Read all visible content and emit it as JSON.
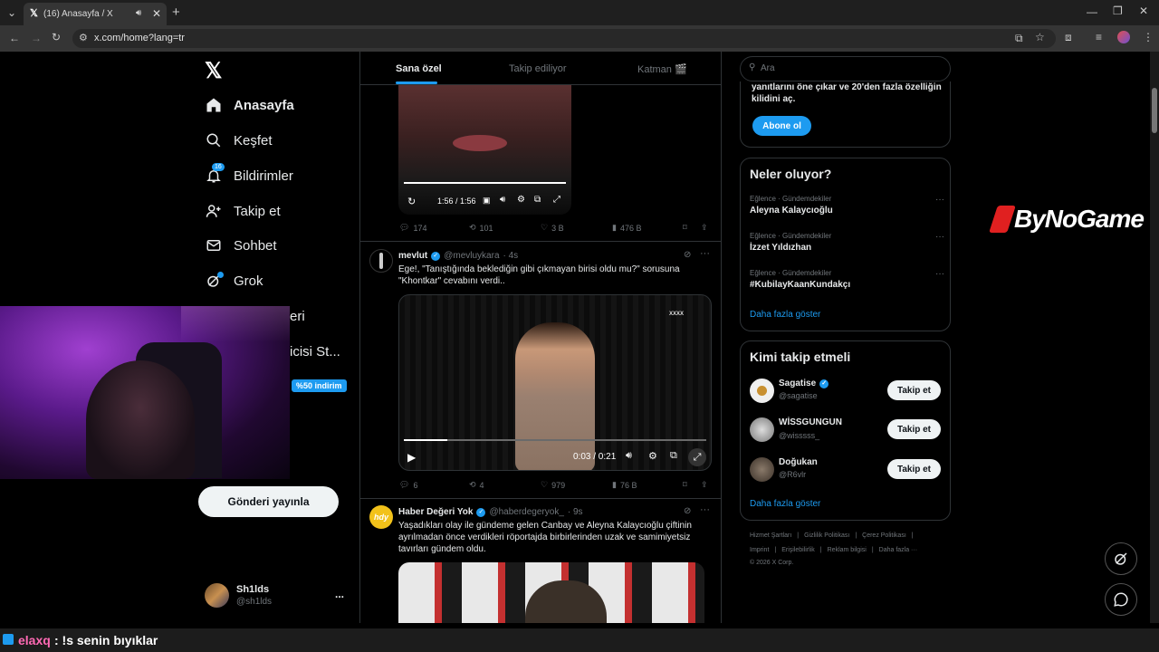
{
  "browser": {
    "tab_title": "(16) Anasayfa / X",
    "url": "x.com/home?lang=tr"
  },
  "nav": {
    "home": "Anasayfa",
    "explore": "Keşfet",
    "notifications": "Bildirimler",
    "notifications_badge": "16",
    "follow": "Takip et",
    "chat": "Sohbet",
    "grok": "Grok",
    "lists_partial": "eri",
    "premium_partial": "icisi St...",
    "discount_badge": "%50 indirim",
    "post_button": "Gönderi yayınla",
    "account_name": "Sh1lds",
    "account_handle": "@sh1lds",
    "account_more": "..."
  },
  "feed": {
    "tabs": [
      "Sana özel",
      "Takip ediliyor",
      "Katman 🎬"
    ],
    "post1": {
      "time": "1:56 / 1:56",
      "replies": "174",
      "reposts": "101",
      "likes": "3 B",
      "views": "476 B"
    },
    "post2": {
      "name": "mevlut",
      "handle": "@mevluykara",
      "time": "· 4s",
      "text": "Ege!, \"Tanıştığında beklediğin gibi çıkmayan birisi oldu mu?\" sorusuna \"Khontkar\" cevabını verdi..",
      "video_time": "0:03 / 0:21",
      "replies": "6",
      "reposts": "4",
      "likes": "979",
      "views": "76 B"
    },
    "post3": {
      "name": "Haber Değeri Yok",
      "handle": "@haberdegeryok_",
      "time": "· 9s",
      "avatar_text": "hdy",
      "text": "Yaşadıkları olay ile gündeme gelen Canbay ve Aleyna Kalaycıoğlu çiftinin ayrılmadan önce verdikleri röportajda birbirlerinden uzak ve samimiyetsiz tavırları gündem oldu."
    }
  },
  "right": {
    "search_placeholder": "Ara",
    "premium_text": "yanıtlarını öne çıkar ve 20'den fazla özelliğin kilidini aç.",
    "subscribe": "Abone ol",
    "trends_title": "Neler oluyor?",
    "trends": [
      {
        "cat": "Eğlence · Gündemdekiler",
        "title": "Aleyna Kalaycıoğlu"
      },
      {
        "cat": "Eğlence · Gündemdekiler",
        "title": "İzzet Yıldızhan"
      },
      {
        "cat": "Eğlence · Gündemdekiler",
        "title": "#KubilayKaanKundakçı"
      }
    ],
    "show_more": "Daha fazla göster",
    "who_title": "Kimi takip etmeli",
    "who": [
      {
        "name": "Sagatise",
        "handle": "@sagatise",
        "verified": true
      },
      {
        "name": "WİSSGUNGUN",
        "handle": "@wisssss_",
        "verified": false
      },
      {
        "name": "Doğukan",
        "handle": "@R6vlr",
        "verified": false
      }
    ],
    "follow_label": "Takip et",
    "who_more": "Daha fazla göster",
    "footer1": [
      "Hizmet Şartları",
      "|",
      "Gizlilik Politikası",
      "|",
      "Çerez Politikası",
      "|"
    ],
    "footer2": [
      "Imprint",
      "|",
      "Erişilebilirlik",
      "|",
      "Reklam bilgisi",
      "|",
      "Daha fazla ···"
    ],
    "footer3": "© 2026 X Corp."
  },
  "overlay": {
    "brand": "ByNoGame",
    "chat_user": "elaxq",
    "chat_message": ": !s senin bıyıklar"
  },
  "colors": {
    "accent": "#1d9bf0",
    "chat_user": "#ff69b4",
    "background": "#000000",
    "border": "#2f3336"
  }
}
